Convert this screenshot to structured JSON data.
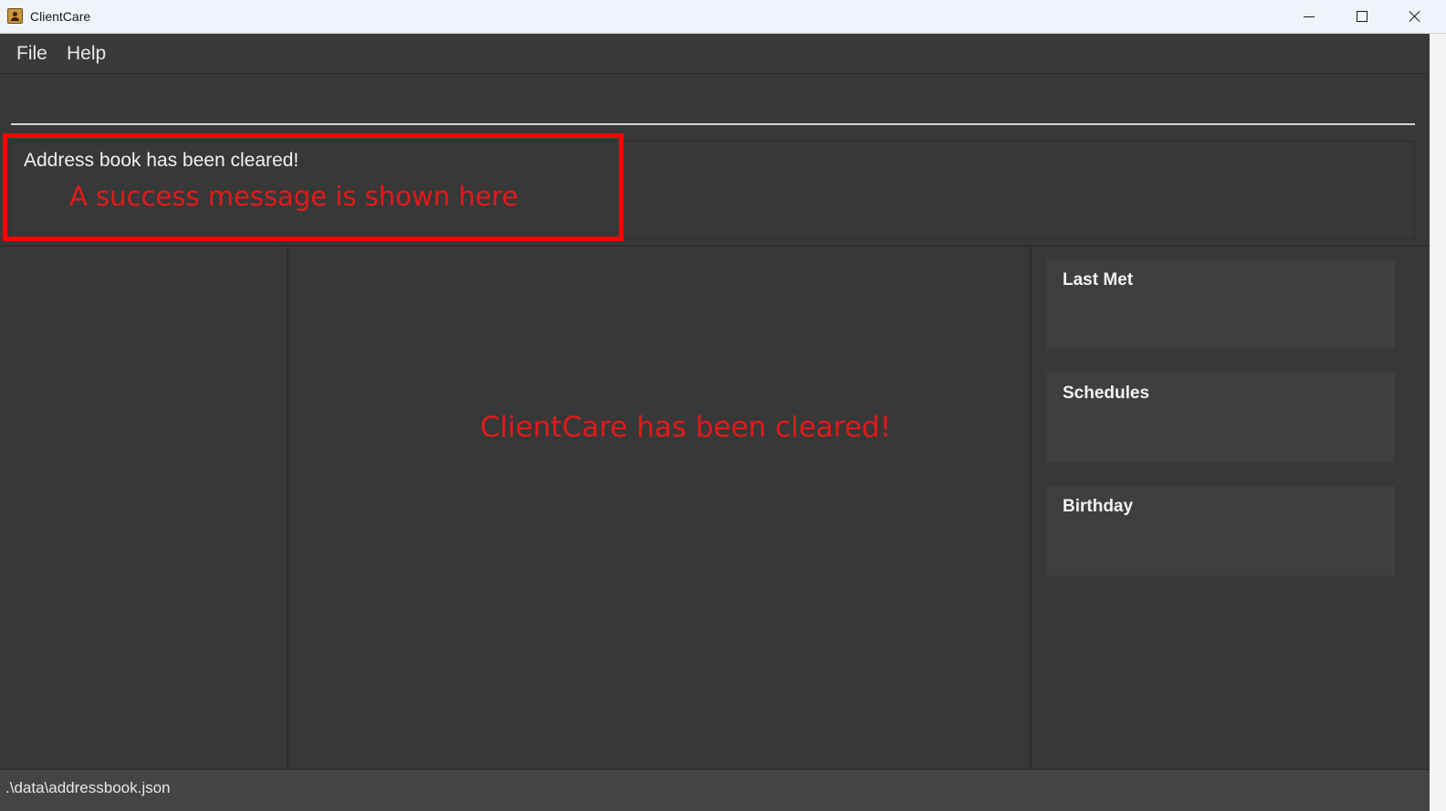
{
  "window": {
    "title": "ClientCare",
    "icon": "address-book-icon"
  },
  "menu": {
    "items": [
      {
        "label": "File"
      },
      {
        "label": "Help"
      }
    ]
  },
  "command": {
    "value": "",
    "placeholder": ""
  },
  "result": {
    "message": "Address book has been cleared!"
  },
  "annotations": {
    "success_note": "A success message is shown here",
    "center_note": "ClientCare has been cleared!",
    "color": "#e31a1a",
    "highlight_color": "#ff0000"
  },
  "side_panels": {
    "last_met": {
      "title": "Last Met"
    },
    "schedules": {
      "title": "Schedules"
    },
    "birthday": {
      "title": "Birthday"
    }
  },
  "status": {
    "path": ".\\data\\addressbook.json"
  }
}
